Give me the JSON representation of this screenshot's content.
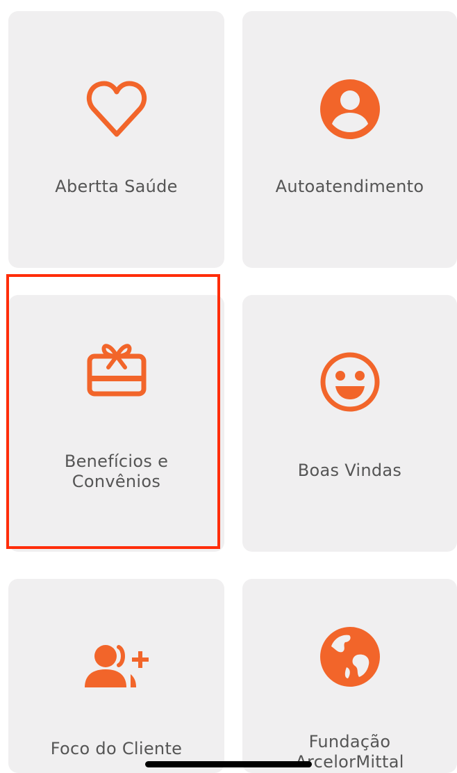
{
  "theme": {
    "accent": "#f2652a",
    "tile_bg": "#f0eff0",
    "label_color": "#555555",
    "highlight": "#ff2d0a"
  },
  "tiles": [
    {
      "label": "Abertta Saúde",
      "icon": "heart-icon"
    },
    {
      "label": "Autoatendimento",
      "icon": "user-circle-icon"
    },
    {
      "label": "Benefícios e Convênios",
      "icon": "gift-card-icon",
      "highlighted": true
    },
    {
      "label": "Boas Vindas",
      "icon": "smile-icon"
    },
    {
      "label": "Foco do Cliente",
      "icon": "user-plus-icon"
    },
    {
      "label": "Fundação ArcelorMittal",
      "icon": "globe-icon"
    }
  ]
}
